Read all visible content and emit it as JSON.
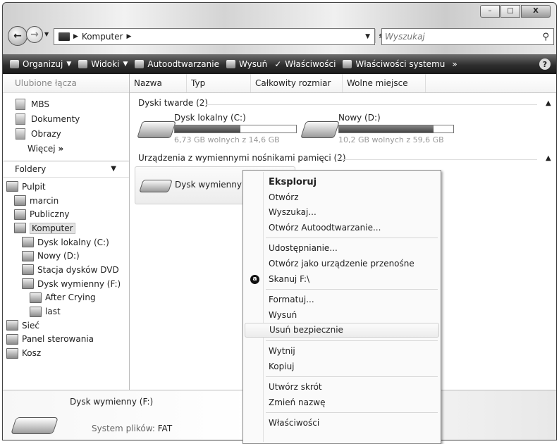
{
  "titlebar": {
    "minimize": "–",
    "maximize": "□",
    "close": "X"
  },
  "address": {
    "crumbs": [
      "Komputer"
    ],
    "search_placeholder": "Wyszukaj"
  },
  "toolbar": {
    "organize": "Organizuj",
    "views": "Widoki",
    "autoplay": "Autoodtwarzanie",
    "eject": "Wysuń",
    "properties": "Właściwości",
    "system_properties": "Właściwości systemu",
    "more": "»",
    "help": "?"
  },
  "sidebar": {
    "favorites_header": "Ulubione łącza",
    "favorites": [
      "MBS",
      "Dokumenty",
      "Obrazy"
    ],
    "more_label": "Więcej",
    "more_arrows": "»",
    "folders_header": "Foldery",
    "tree": [
      {
        "label": "Pulpit",
        "indent": 0,
        "icon": "desktop-icon"
      },
      {
        "label": "marcin",
        "indent": 1,
        "icon": "user-folder-icon"
      },
      {
        "label": "Publiczny",
        "indent": 1,
        "icon": "folder-icon"
      },
      {
        "label": "Komputer",
        "indent": 1,
        "icon": "computer-icon",
        "selected": true
      },
      {
        "label": "Dysk lokalny (C:)",
        "indent": 2,
        "icon": "hard-drive-icon"
      },
      {
        "label": "Nowy (D:)",
        "indent": 2,
        "icon": "hard-drive-icon"
      },
      {
        "label": "Stacja dysków DVD",
        "indent": 2,
        "icon": "dvd-drive-icon"
      },
      {
        "label": "Dysk wymienny (F:)",
        "indent": 2,
        "icon": "removable-drive-icon"
      },
      {
        "label": "After Crying",
        "indent": 3,
        "icon": "folder-icon"
      },
      {
        "label": "last",
        "indent": 3,
        "icon": "folder-icon"
      },
      {
        "label": "Sieć",
        "indent": 0,
        "icon": "network-icon"
      },
      {
        "label": "Panel sterowania",
        "indent": 0,
        "icon": "control-panel-icon"
      },
      {
        "label": "Kosz",
        "indent": 0,
        "icon": "recycle-bin-icon"
      }
    ]
  },
  "columns": [
    "Nazwa",
    "Typ",
    "Całkowity rozmiar",
    "Wolne miejsce"
  ],
  "groups": {
    "hard_drives": "Dyski twarde (2)",
    "removable": "Urządzenia z wymiennymi nośnikami pamięci (2)"
  },
  "drives": [
    {
      "name": "Dysk lokalny (C:)",
      "free_text": "6,73 GB wolnych z 14,6 GB",
      "used_fraction": 0.54
    },
    {
      "name": "Nowy (D:)",
      "free_text": "10,2 GB wolnych z 59,6 GB",
      "used_fraction": 0.83
    }
  ],
  "removable_drive": {
    "name": "Dysk wymienny (F"
  },
  "context_menu": [
    {
      "label": "Eksploruj",
      "bold": true
    },
    {
      "label": "Otwórz"
    },
    {
      "label": "Wyszukaj..."
    },
    {
      "label": "Otwórz Autoodtwarzanie..."
    },
    {
      "sep": true
    },
    {
      "label": "Udostępnianie..."
    },
    {
      "label": "Otwórz jako urządzenie przenośne"
    },
    {
      "label": "Skanuj F:\\",
      "icon": "avast-icon",
      "icon_glyph": "a"
    },
    {
      "sep": true
    },
    {
      "label": "Formatuj..."
    },
    {
      "label": "Wysuń"
    },
    {
      "label": "Usuń bezpiecznie",
      "highlight": true
    },
    {
      "sep": true
    },
    {
      "label": "Wytnij"
    },
    {
      "label": "Kopiuj"
    },
    {
      "sep": true
    },
    {
      "label": "Utwórz skrót"
    },
    {
      "label": "Zmień nazwę"
    },
    {
      "sep": true
    },
    {
      "label": "Właściwości"
    }
  ],
  "details": {
    "name": "Dysk wymienny (F:)",
    "fs_label": "System plików:",
    "fs_value": "FAT"
  }
}
